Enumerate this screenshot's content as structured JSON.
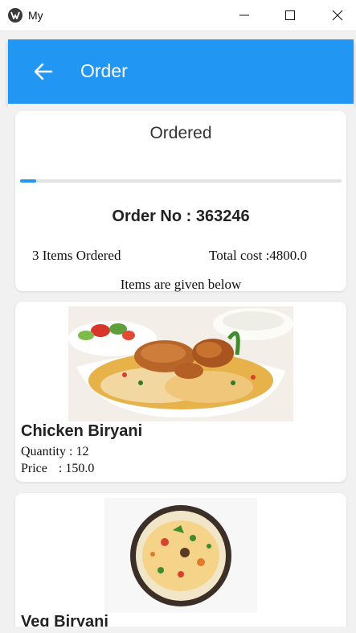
{
  "window": {
    "title": "My"
  },
  "appbar": {
    "title": "Order",
    "color": "#2196f3"
  },
  "order": {
    "status": "Ordered",
    "progress": 0.05,
    "order_no_label": "Order No : 363246",
    "items_ordered": "3 Items Ordered",
    "total_cost": "Total cost :4800.0",
    "items_note": "Items are given below"
  },
  "items": [
    {
      "name": "Chicken Biryani",
      "quantity": "Quantity : 12",
      "price_label": "Price",
      "price_value": ": 150.0",
      "image": "chicken-biryani-image"
    },
    {
      "name": "Veg Biryani",
      "image": "veg-biryani-image"
    }
  ]
}
